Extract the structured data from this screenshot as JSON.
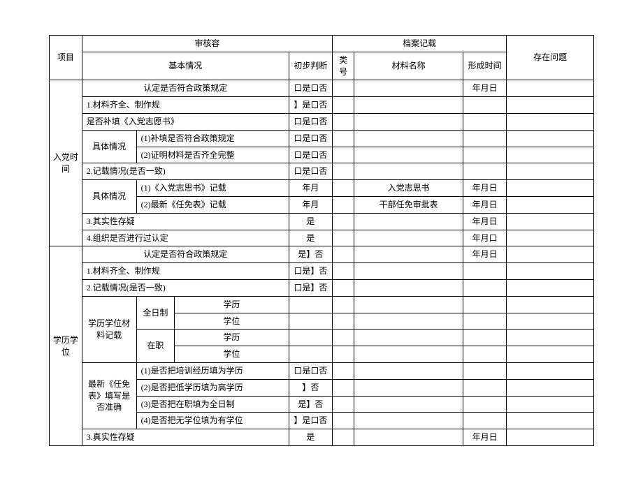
{
  "headers": {
    "project": "项目",
    "auditContent": "审核容",
    "archiveRecord": "档案记载",
    "issues": "存在问题",
    "basicSituation": "基本情况",
    "preliminaryJudgment": "初步判断",
    "categoryNo": "类号",
    "materialName": "材料名称",
    "formationTime": "形成时间"
  },
  "lead": {
    "policy": "认定是否符合政策规定",
    "judgment": "口是口否",
    "time": "年月日"
  },
  "section1": {
    "title": "入党时间",
    "r1": {
      "label": "1.材料齐全、制作规",
      "judgment": "】是口否"
    },
    "r2": {
      "label": "是否补填《入党志愿书》",
      "judgment": "口是口否"
    },
    "r3": {
      "rowLabel": "具体情况",
      "a": {
        "label": "(1)补填是否符合政策规定",
        "judgment": "口是口否"
      },
      "b": {
        "label": "(2)证明材料是否齐全完整",
        "judgment": "口是口否"
      }
    },
    "r4": {
      "label": "2.记载情况(是否一致)",
      "judgment": "口是口否"
    },
    "r5": {
      "rowLabel": "具体情况",
      "a": {
        "label": "(1)《入党志思书》记载",
        "judgment": "年月",
        "material": "入党志思书",
        "time": "年月日"
      },
      "b": {
        "label": "(2)最新《任免表》记载",
        "judgment": "年月",
        "material": "干部任免审批表",
        "time": "年月日"
      }
    },
    "r6": {
      "label": "3.其实性存疑",
      "judgment": "是",
      "time": "年月日"
    },
    "r7": {
      "label": "4.组织是否进行过认定",
      "judgment": "是",
      "time": "年月口"
    },
    "r8": {
      "label": "认定是否符合政策规定",
      "judgment": "是】否",
      "time": "年月日"
    }
  },
  "section2": {
    "title": "学历学位",
    "r1": {
      "label": "1.材料齐全、制作规",
      "judgment": "口是】否"
    },
    "r2": {
      "label": "2.记载情况(是否一致)",
      "judgment": "口是】否"
    },
    "matrix": {
      "rowLabel": "学历学位材料记载",
      "fullTime": "全日制",
      "onJob": "在职",
      "edu": "学历",
      "degree": "学位"
    },
    "latest": {
      "rowLabel": "最新《任免表》填写是否准确",
      "a": {
        "label": "(1)是否把培训经历填为学历",
        "judgment": "口是口否"
      },
      "b": {
        "label": "(2)是否把低学历填为高学历",
        "judgment": "】否"
      },
      "c": {
        "label": "(3)是否把在职填为全日制",
        "judgment": "是】否"
      },
      "d": {
        "label": "(4)是否把无学位填为有学位",
        "judgment": "】是口否"
      }
    },
    "r3": {
      "label": "3.真实性存疑",
      "judgment": "是",
      "time": "年月日"
    }
  }
}
